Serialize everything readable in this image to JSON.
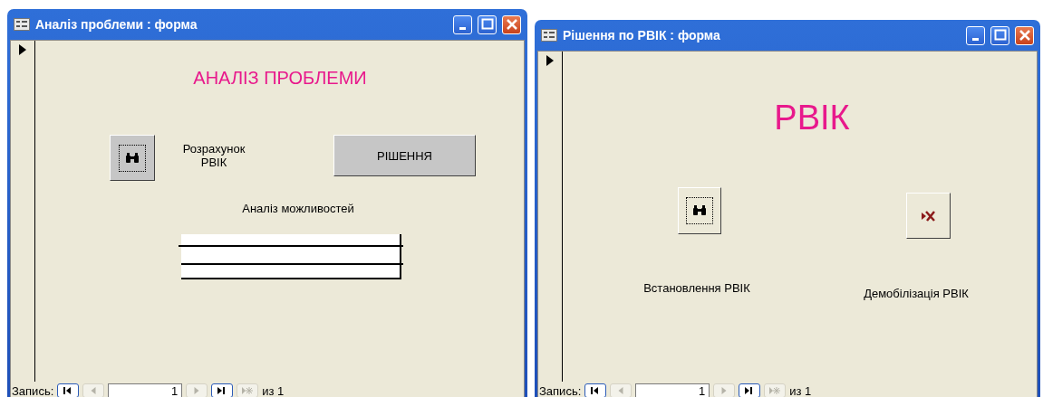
{
  "windows": [
    {
      "title": "Аналіз проблеми : форма",
      "controls": [
        {
          "kind": "heading",
          "text": "АНАЛІЗ ПРОБЛЕМИ"
        },
        {
          "kind": "search_button"
        },
        {
          "kind": "label",
          "text": "Розрахунок РВІК"
        },
        {
          "kind": "button",
          "text": "РІШЕННЯ"
        },
        {
          "kind": "label",
          "text": "Аналіз можливостей"
        },
        {
          "kind": "subform"
        }
      ],
      "record_label": "Запись:",
      "record_number": "1",
      "record_total": "из 1",
      "nav_buttons": [
        {
          "kind": "first",
          "disabled": false
        },
        {
          "kind": "prev",
          "disabled": true
        },
        {
          "kind": "field"
        },
        {
          "kind": "next",
          "disabled": true
        },
        {
          "kind": "last",
          "disabled": false
        },
        {
          "kind": "new",
          "disabled": true
        }
      ]
    },
    {
      "title": "Рішення по РВІК : форма",
      "controls": [
        {
          "kind": "heading",
          "text": "РВІК"
        },
        {
          "kind": "search_button"
        },
        {
          "kind": "exit_button"
        },
        {
          "kind": "label",
          "text": "Встановлення РВІК"
        },
        {
          "kind": "label",
          "text": "Демобілізація РВІК"
        }
      ],
      "record_label": "Запись:",
      "record_number": "1",
      "record_total": "из 1",
      "nav_buttons": [
        {
          "kind": "first",
          "disabled": false
        },
        {
          "kind": "prev",
          "disabled": true
        },
        {
          "kind": "field"
        },
        {
          "kind": "next",
          "disabled": true
        },
        {
          "kind": "last",
          "disabled": false
        },
        {
          "kind": "new",
          "disabled": true
        }
      ]
    }
  ]
}
